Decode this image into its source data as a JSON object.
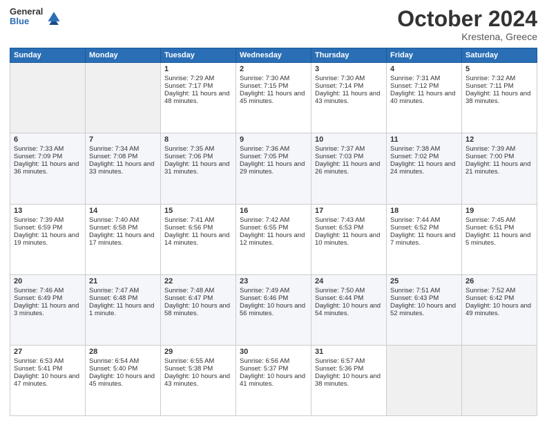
{
  "header": {
    "logo_line1": "General",
    "logo_line2": "Blue",
    "month": "October 2024",
    "location": "Krestena, Greece"
  },
  "days_of_week": [
    "Sunday",
    "Monday",
    "Tuesday",
    "Wednesday",
    "Thursday",
    "Friday",
    "Saturday"
  ],
  "weeks": [
    [
      {
        "day": "",
        "sunrise": "",
        "sunset": "",
        "daylight": ""
      },
      {
        "day": "",
        "sunrise": "",
        "sunset": "",
        "daylight": ""
      },
      {
        "day": "1",
        "sunrise": "Sunrise: 7:29 AM",
        "sunset": "Sunset: 7:17 PM",
        "daylight": "Daylight: 11 hours and 48 minutes."
      },
      {
        "day": "2",
        "sunrise": "Sunrise: 7:30 AM",
        "sunset": "Sunset: 7:15 PM",
        "daylight": "Daylight: 11 hours and 45 minutes."
      },
      {
        "day": "3",
        "sunrise": "Sunrise: 7:30 AM",
        "sunset": "Sunset: 7:14 PM",
        "daylight": "Daylight: 11 hours and 43 minutes."
      },
      {
        "day": "4",
        "sunrise": "Sunrise: 7:31 AM",
        "sunset": "Sunset: 7:12 PM",
        "daylight": "Daylight: 11 hours and 40 minutes."
      },
      {
        "day": "5",
        "sunrise": "Sunrise: 7:32 AM",
        "sunset": "Sunset: 7:11 PM",
        "daylight": "Daylight: 11 hours and 38 minutes."
      }
    ],
    [
      {
        "day": "6",
        "sunrise": "Sunrise: 7:33 AM",
        "sunset": "Sunset: 7:09 PM",
        "daylight": "Daylight: 11 hours and 36 minutes."
      },
      {
        "day": "7",
        "sunrise": "Sunrise: 7:34 AM",
        "sunset": "Sunset: 7:08 PM",
        "daylight": "Daylight: 11 hours and 33 minutes."
      },
      {
        "day": "8",
        "sunrise": "Sunrise: 7:35 AM",
        "sunset": "Sunset: 7:06 PM",
        "daylight": "Daylight: 11 hours and 31 minutes."
      },
      {
        "day": "9",
        "sunrise": "Sunrise: 7:36 AM",
        "sunset": "Sunset: 7:05 PM",
        "daylight": "Daylight: 11 hours and 29 minutes."
      },
      {
        "day": "10",
        "sunrise": "Sunrise: 7:37 AM",
        "sunset": "Sunset: 7:03 PM",
        "daylight": "Daylight: 11 hours and 26 minutes."
      },
      {
        "day": "11",
        "sunrise": "Sunrise: 7:38 AM",
        "sunset": "Sunset: 7:02 PM",
        "daylight": "Daylight: 11 hours and 24 minutes."
      },
      {
        "day": "12",
        "sunrise": "Sunrise: 7:39 AM",
        "sunset": "Sunset: 7:00 PM",
        "daylight": "Daylight: 11 hours and 21 minutes."
      }
    ],
    [
      {
        "day": "13",
        "sunrise": "Sunrise: 7:39 AM",
        "sunset": "Sunset: 6:59 PM",
        "daylight": "Daylight: 11 hours and 19 minutes."
      },
      {
        "day": "14",
        "sunrise": "Sunrise: 7:40 AM",
        "sunset": "Sunset: 6:58 PM",
        "daylight": "Daylight: 11 hours and 17 minutes."
      },
      {
        "day": "15",
        "sunrise": "Sunrise: 7:41 AM",
        "sunset": "Sunset: 6:56 PM",
        "daylight": "Daylight: 11 hours and 14 minutes."
      },
      {
        "day": "16",
        "sunrise": "Sunrise: 7:42 AM",
        "sunset": "Sunset: 6:55 PM",
        "daylight": "Daylight: 11 hours and 12 minutes."
      },
      {
        "day": "17",
        "sunrise": "Sunrise: 7:43 AM",
        "sunset": "Sunset: 6:53 PM",
        "daylight": "Daylight: 11 hours and 10 minutes."
      },
      {
        "day": "18",
        "sunrise": "Sunrise: 7:44 AM",
        "sunset": "Sunset: 6:52 PM",
        "daylight": "Daylight: 11 hours and 7 minutes."
      },
      {
        "day": "19",
        "sunrise": "Sunrise: 7:45 AM",
        "sunset": "Sunset: 6:51 PM",
        "daylight": "Daylight: 11 hours and 5 minutes."
      }
    ],
    [
      {
        "day": "20",
        "sunrise": "Sunrise: 7:46 AM",
        "sunset": "Sunset: 6:49 PM",
        "daylight": "Daylight: 11 hours and 3 minutes."
      },
      {
        "day": "21",
        "sunrise": "Sunrise: 7:47 AM",
        "sunset": "Sunset: 6:48 PM",
        "daylight": "Daylight: 11 hours and 1 minute."
      },
      {
        "day": "22",
        "sunrise": "Sunrise: 7:48 AM",
        "sunset": "Sunset: 6:47 PM",
        "daylight": "Daylight: 10 hours and 58 minutes."
      },
      {
        "day": "23",
        "sunrise": "Sunrise: 7:49 AM",
        "sunset": "Sunset: 6:46 PM",
        "daylight": "Daylight: 10 hours and 56 minutes."
      },
      {
        "day": "24",
        "sunrise": "Sunrise: 7:50 AM",
        "sunset": "Sunset: 6:44 PM",
        "daylight": "Daylight: 10 hours and 54 minutes."
      },
      {
        "day": "25",
        "sunrise": "Sunrise: 7:51 AM",
        "sunset": "Sunset: 6:43 PM",
        "daylight": "Daylight: 10 hours and 52 minutes."
      },
      {
        "day": "26",
        "sunrise": "Sunrise: 7:52 AM",
        "sunset": "Sunset: 6:42 PM",
        "daylight": "Daylight: 10 hours and 49 minutes."
      }
    ],
    [
      {
        "day": "27",
        "sunrise": "Sunrise: 6:53 AM",
        "sunset": "Sunset: 5:41 PM",
        "daylight": "Daylight: 10 hours and 47 minutes."
      },
      {
        "day": "28",
        "sunrise": "Sunrise: 6:54 AM",
        "sunset": "Sunset: 5:40 PM",
        "daylight": "Daylight: 10 hours and 45 minutes."
      },
      {
        "day": "29",
        "sunrise": "Sunrise: 6:55 AM",
        "sunset": "Sunset: 5:38 PM",
        "daylight": "Daylight: 10 hours and 43 minutes."
      },
      {
        "day": "30",
        "sunrise": "Sunrise: 6:56 AM",
        "sunset": "Sunset: 5:37 PM",
        "daylight": "Daylight: 10 hours and 41 minutes."
      },
      {
        "day": "31",
        "sunrise": "Sunrise: 6:57 AM",
        "sunset": "Sunset: 5:36 PM",
        "daylight": "Daylight: 10 hours and 38 minutes."
      },
      {
        "day": "",
        "sunrise": "",
        "sunset": "",
        "daylight": ""
      },
      {
        "day": "",
        "sunrise": "",
        "sunset": "",
        "daylight": ""
      }
    ]
  ]
}
